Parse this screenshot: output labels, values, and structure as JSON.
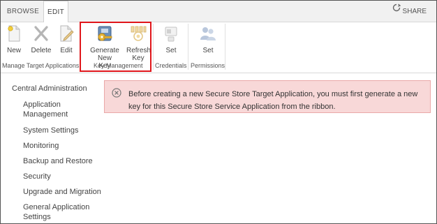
{
  "tabs": [
    {
      "label": "BROWSE",
      "selected": false
    },
    {
      "label": "EDIT",
      "selected": true
    }
  ],
  "share": {
    "label": "SHARE",
    "icon": "share-icon"
  },
  "ribbon": {
    "groups": {
      "manage": {
        "label": "Manage Target Applications",
        "buttons": [
          {
            "label": "New",
            "icon": "new-document-icon"
          },
          {
            "label": "Delete",
            "icon": "delete-x-icon"
          },
          {
            "label": "Edit",
            "icon": "edit-document-icon"
          }
        ]
      },
      "key": {
        "label": "Key Management",
        "buttons": [
          {
            "label_line1": "Generate New",
            "label_line2": "Key",
            "icon": "generate-key-icon"
          },
          {
            "label_line1": "Refresh",
            "label_line2": "Key",
            "icon": "refresh-key-icon"
          }
        ]
      },
      "credentials": {
        "label": "Credentials",
        "button": {
          "label": "Set",
          "icon": "set-credentials-icon"
        }
      },
      "permissions": {
        "label": "Permissions",
        "button": {
          "label": "Set",
          "icon": "set-permissions-icon"
        }
      }
    }
  },
  "nav": {
    "root": "Central Administration",
    "items": [
      "Application Management",
      "System Settings",
      "Monitoring",
      "Backup and Restore",
      "Security",
      "Upgrade and Migration",
      "General Application Settings"
    ]
  },
  "error": {
    "icon": "error-circle-icon",
    "message": "Before creating a new Secure Store Target Application, you must first generate a new key for this Secure Store  Service Application from the ribbon."
  },
  "colors": {
    "highlight": "#e0161b",
    "error_background": "#f8d8d8",
    "error_border": "#eaa8a8"
  }
}
